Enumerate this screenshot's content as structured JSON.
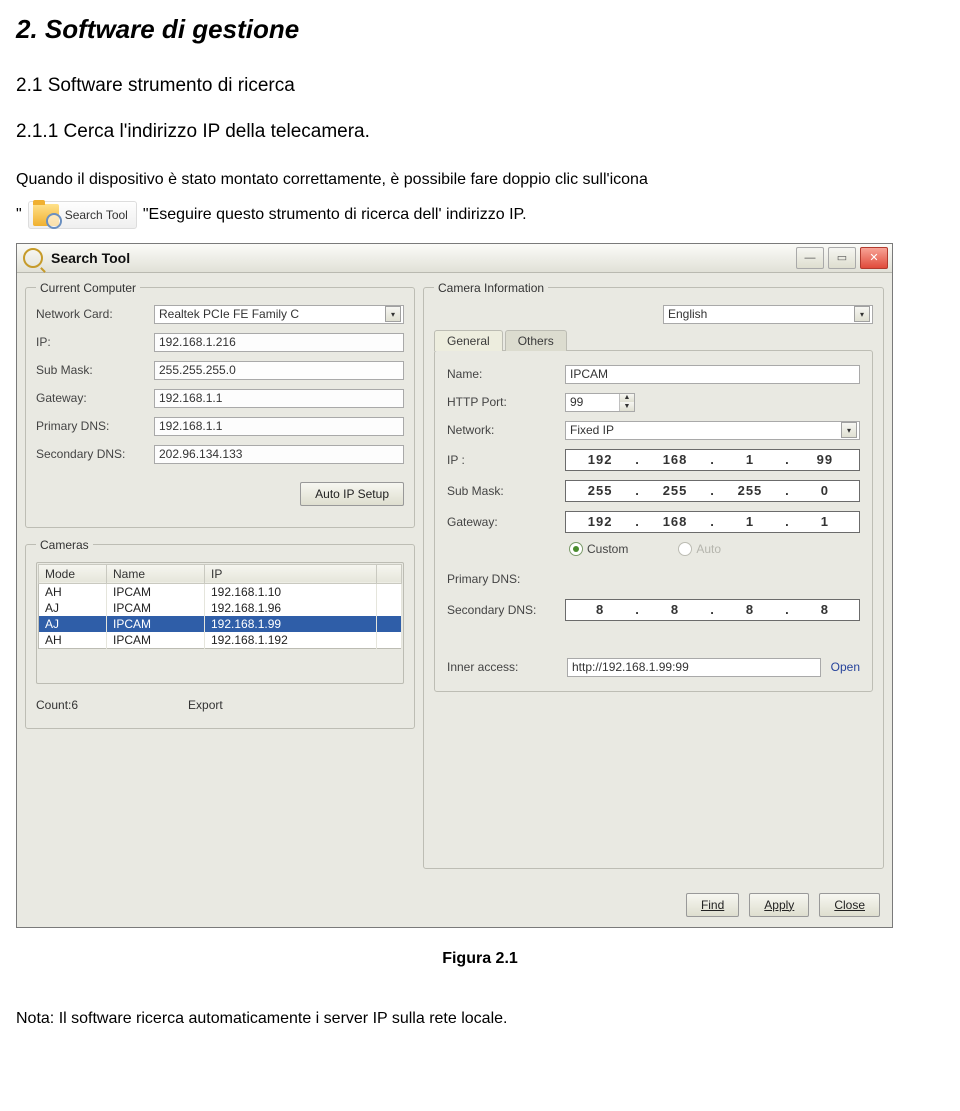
{
  "doc": {
    "h2": "2. Software di gestione",
    "h3": "2.1 Software strumento di ricerca",
    "h4": "2.1.1 Cerca l'indirizzo IP della telecamera.",
    "para1": "Quando il dispositivo è stato montato correttamente, è possibile fare doppio clic sull'icona",
    "iconLabel": "Search Tool",
    "para2_after": "\"Eseguire questo strumento di ricerca dell' indirizzo IP.",
    "figure": "Figura 2.1",
    "note": "Nota: Il software ricerca automaticamente i server IP sulla rete locale."
  },
  "win": {
    "title": "Search Tool",
    "lang": "English",
    "left": {
      "legend": "Current Computer",
      "networkCard_lbl": "Network Card:",
      "networkCard": "Realtek PCIe FE Family C",
      "ip_lbl": "IP:",
      "ip": "192.168.1.216",
      "subMask_lbl": "Sub Mask:",
      "subMask": "255.255.255.0",
      "gateway_lbl": "Gateway:",
      "gateway": "192.168.1.1",
      "pdns_lbl": "Primary DNS:",
      "pdns": "192.168.1.1",
      "sdns_lbl": "Secondary DNS:",
      "sdns": "202.96.134.133",
      "autoBtn": "Auto IP Setup"
    },
    "cams": {
      "legend": "Cameras",
      "cols": [
        "Mode",
        "Name",
        "IP"
      ],
      "rows": [
        {
          "mode": "AH",
          "name": "IPCAM",
          "ip": "192.168.1.10",
          "sel": false
        },
        {
          "mode": "AJ",
          "name": "IPCAM",
          "ip": "192.168.1.96",
          "sel": false
        },
        {
          "mode": "AJ",
          "name": "IPCAM",
          "ip": "192.168.1.99",
          "sel": true
        },
        {
          "mode": "AH",
          "name": "IPCAM",
          "ip": "192.168.1.192",
          "sel": false
        }
      ],
      "count_lbl": "Count:6",
      "export": "Export"
    },
    "right": {
      "legend": "Camera Information",
      "tabGeneral": "General",
      "tabOthers": "Others",
      "name_lbl": "Name:",
      "name": "IPCAM",
      "http_lbl": "HTTP Port:",
      "http": "99",
      "network_lbl": "Network:",
      "network": "Fixed IP",
      "ip_lbl": "IP  :",
      "ip": [
        "192",
        "168",
        "1",
        "99"
      ],
      "sub_lbl": "Sub Mask:",
      "sub": [
        "255",
        "255",
        "255",
        "0"
      ],
      "gw_lbl": "Gateway:",
      "gw": [
        "192",
        "168",
        "1",
        "1"
      ],
      "custom": "Custom",
      "auto": "Auto",
      "pdns_lbl": "Primary DNS:",
      "sdns_lbl": "Secondary DNS:",
      "sdns": [
        "8",
        "8",
        "8",
        "8"
      ],
      "inner_lbl": "Inner access:",
      "inner": "http://192.168.1.99:99",
      "open": "Open"
    },
    "footer": {
      "find": "Find",
      "apply": "Apply",
      "close": "Close"
    }
  }
}
